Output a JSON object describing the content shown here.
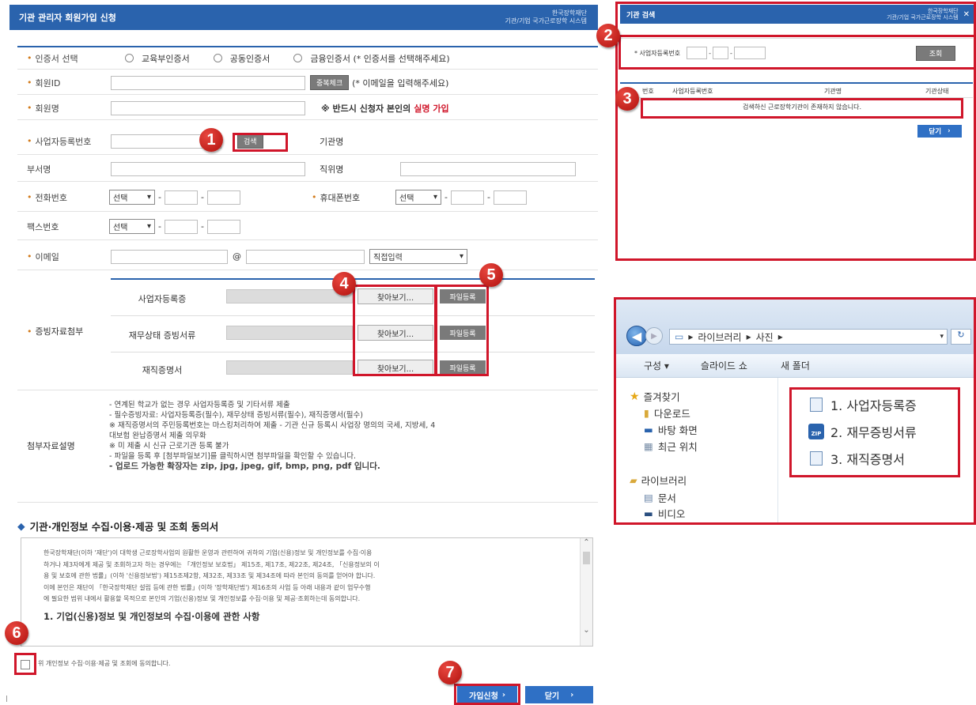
{
  "left_form": {
    "title": "기관 관리자 회원가입 신청",
    "brand_line1": "한국장학재단",
    "brand_line2": "기관/기업 국가근로장학 시스템",
    "cert": {
      "label": "인증서 선택",
      "options": [
        "교육부인증서",
        "공동인증서",
        "금융인증서 (* 인증서를 선택해주세요)"
      ]
    },
    "member_id": {
      "label": "회원ID",
      "check_button": "중복체크",
      "hint": "(* 이메일을 입력해주세요)"
    },
    "member_name": {
      "label": "회원명",
      "hint_prefix": "※ 반드시 신청자 본인의",
      "hint_red": "실명 가입"
    },
    "biz_no": {
      "label": "사업자등록번호",
      "search_button": "검색",
      "org_label": "기관명"
    },
    "dept": {
      "label": "부서명",
      "position_label": "직위명"
    },
    "phone": {
      "label": "전화번호",
      "select": "선택",
      "mobile_label": "휴대폰번호"
    },
    "fax": {
      "label": "팩스번호",
      "select": "선택"
    },
    "email": {
      "label": "이메일",
      "at": "@",
      "select": "직접입력"
    },
    "attach": {
      "label": "증빙자료첨부",
      "items": [
        {
          "label": "사업자등록증",
          "browse": "찾아보기...",
          "register": "파일등록"
        },
        {
          "label": "재무상태 증빙서류",
          "browse": "찾아보기...",
          "register": "파일등록"
        },
        {
          "label": "재직증명서",
          "browse": "찾아보기...",
          "register": "파일등록"
        }
      ]
    },
    "desc": {
      "label": "첨부자료설명",
      "lines": [
        "- 연계된 학교가 없는 경우 사업자등록증 및 기타서류 제출",
        "- 필수증빙자료: 사업자등록증(필수), 재무상태 증빙서류(필수), 재직증명서(필수)",
        "   ※ 재직증명서의 주민등록번호는 마스킹처리하여 제출 - 기관 신규 등록시 사업장 명의의 국세, 지방세, 4",
        "   대보험 완납증명서 제출 의무화",
        "   ※ 미 제출 시 신규 근로기관 등록 불가",
        "- 파일을 등록 후 [첨부파일보기]를 클릭하시면 첨부파일을 확인할 수 있습니다.",
        "- 업로드 가능한 확장자는 zip, jpg, jpeg, gif, bmp, png, pdf 입니다."
      ]
    }
  },
  "consent": {
    "section_title": "기관·개인정보 수집·이용·제공 및 조회 동의서",
    "text_lines": [
      "한국장학재단(이하 '재단')이 대학생 근로장학사업의 원활한 운영과 관련하여 귀하의 기업(신용)정보 및 개인정보를 수집·이용",
      "하거나 제3자에게 제공 및 조회하고자 하는 경우에는 「개인정보 보호법」 제15조, 제17조, 제22조, 제24조, 「신용정보의 이",
      "용 및 보호에 관한 법률」(이하 '신용정보법') 제15조제2항, 제32조, 제33조 및 제34조에 따라 본인의 동의를 얻어야 합니다.",
      "이에 본인은 재단이 「한국장학재단 설립 등에 관한 법률」(이하 '장학재단법') 제16조의 사업 등 아래 내용과 같이 업무수행",
      "에 필요한 범위 내에서 활용할 목적으로 본인의 기업(신용)정보 및 개인정보를 수집·이용 및 제공·조회하는데 동의합니다."
    ],
    "subheading": "1. 기업(신용)정보 및 개인정보의 수집·이용에 관한 사항",
    "agree_label": "위 개인정보 수집·이용·제공 및 조회에 동의합니다.",
    "join_button": "가입신청",
    "close_button": "닫기"
  },
  "org_search": {
    "title": "기관 검색",
    "brand_line1": "한국장학재단",
    "brand_line2": "기관/기업 국가근로장학 시스템",
    "biz_label": "* 사업자등록번호",
    "search_button": "조회",
    "columns": [
      "번호",
      "사업자등록번호",
      "기관명",
      "기관상태"
    ],
    "empty_message": "검색하신 근로장학기관이 존재하지 않습니다.",
    "close_button": "닫기"
  },
  "explorer": {
    "breadcrumb": [
      "라이브러리",
      "사진"
    ],
    "toolbar": [
      "구성 ▾",
      "슬라이드 쇼",
      "새 폴더"
    ],
    "favorites_title": "즐겨찾기",
    "favorites": [
      "다운로드",
      "바탕 화면",
      "최근 위치"
    ],
    "libraries_title": "라이브러리",
    "libraries": [
      "문서",
      "비디오"
    ],
    "files": [
      "1. 사업자등록증",
      "2. 재무증빙서류",
      "3. 재직증명서"
    ]
  },
  "badges": [
    "1",
    "2",
    "3",
    "4",
    "5",
    "6",
    "7"
  ],
  "colors": {
    "accent_blue": "#2a63ad",
    "highlight_red": "#d0162a",
    "required_orange": "#d27a1a"
  }
}
